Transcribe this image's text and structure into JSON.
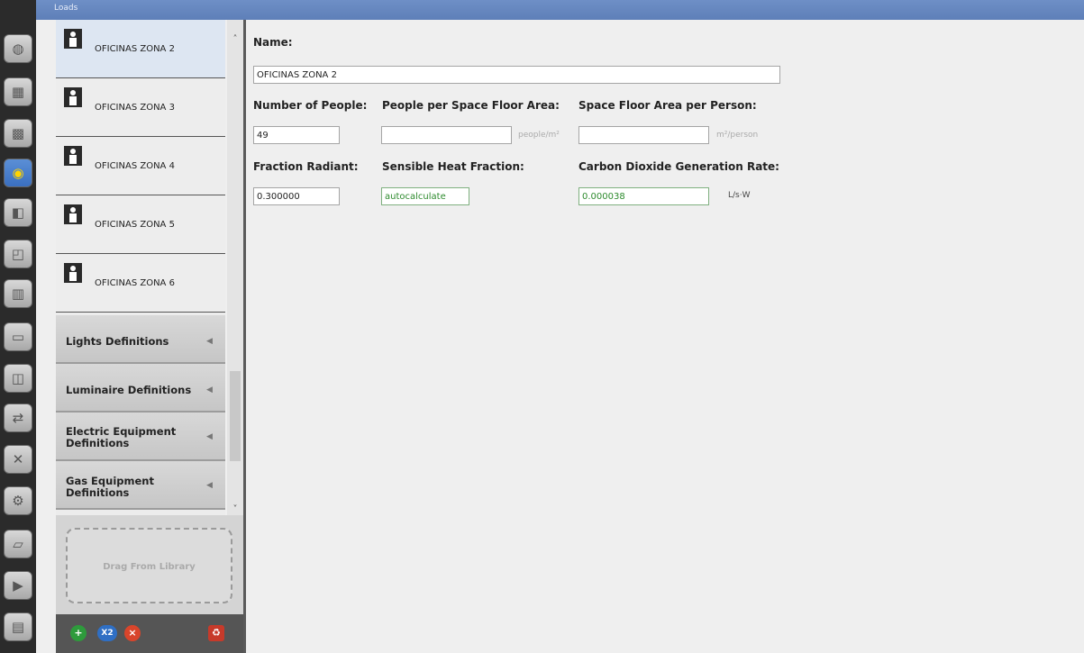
{
  "window": {
    "title": "Loads"
  },
  "toolbar": {
    "icons": [
      "site-icon",
      "schedules-icon",
      "constructions-icon",
      "loads-icon",
      "space-types-icon",
      "geometry-icon",
      "facility-icon",
      "spaces-icon",
      "thermal-zones-icon",
      "hvac-systems-icon",
      "variables-icon",
      "simulation-settings-icon",
      "scripts-icon",
      "run-icon",
      "results-icon"
    ],
    "active": "loads-icon"
  },
  "list": {
    "items": [
      {
        "label": "OFICINAS ZONA 2",
        "selected": true
      },
      {
        "label": "OFICINAS ZONA 3",
        "selected": false
      },
      {
        "label": "OFICINAS ZONA 4",
        "selected": false
      },
      {
        "label": "OFICINAS ZONA 5",
        "selected": false
      },
      {
        "label": "OFICINAS ZONA 6",
        "selected": false
      }
    ],
    "categories": [
      {
        "label": "Lights Definitions"
      },
      {
        "label": "Luminaire Definitions"
      },
      {
        "label": "Electric Equipment Definitions"
      },
      {
        "label": "Gas Equipment Definitions"
      }
    ],
    "drag_text": "Drag From Library"
  },
  "bottom_buttons": {
    "duplicate": "X2"
  },
  "form": {
    "name_label": "Name:",
    "name_value": "OFICINAS ZONA 2",
    "num_people_label": "Number of People:",
    "num_people_value": "49",
    "people_per_area_label": "People per Space Floor Area:",
    "people_per_area_value": "",
    "people_per_area_unit": "people/m²",
    "area_per_person_label": "Space Floor Area per Person:",
    "area_per_person_value": "",
    "area_per_person_unit": "m²/person",
    "fraction_radiant_label": "Fraction Radiant:",
    "fraction_radiant_value": "0.300000",
    "sensible_heat_label": "Sensible Heat Fraction:",
    "sensible_heat_value": "autocalculate",
    "co2_label": "Carbon Dioxide Generation Rate:",
    "co2_value": "0.000038",
    "co2_unit": "L/s·W"
  }
}
